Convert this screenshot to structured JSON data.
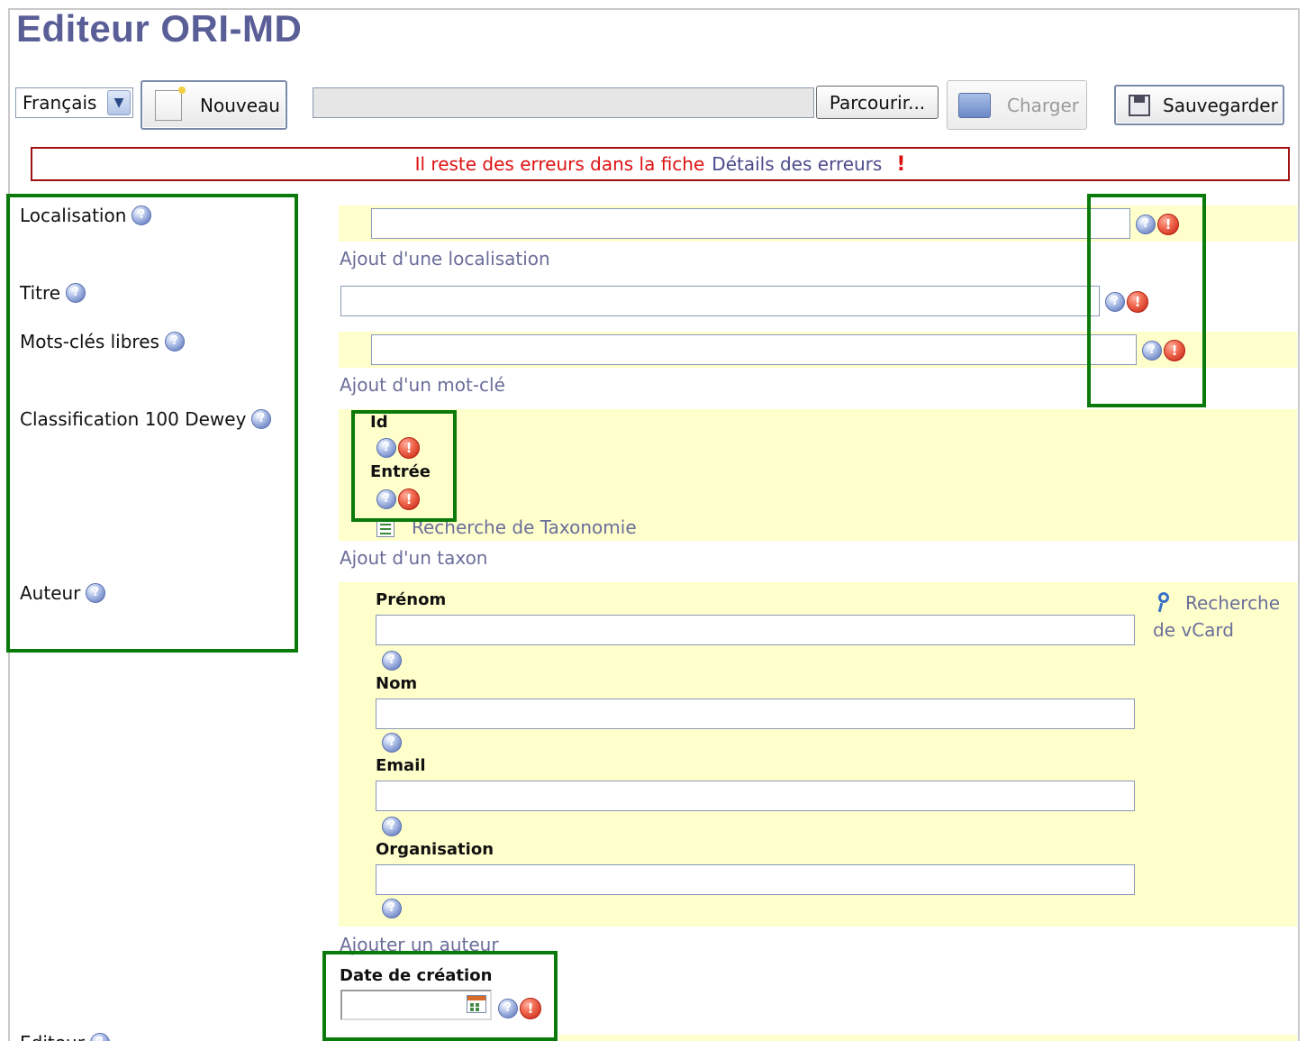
{
  "app": {
    "title": "Editeur ORI-MD"
  },
  "toolbar": {
    "language": "Français",
    "new_label": "Nouveau",
    "file_value": "",
    "browse_label": "Parcourir...",
    "load_label": "Charger",
    "save_label": "Sauvegarder"
  },
  "errors": {
    "message": "Il reste des erreurs dans la fiche",
    "details_link": "Détails des erreurs",
    "indicator": "!"
  },
  "fields": {
    "localisation": {
      "label": "Localisation",
      "value": "",
      "add_link": "Ajout d'une localisation"
    },
    "titre": {
      "label": "Titre",
      "value": ""
    },
    "mots_cles": {
      "label": "Mots-clés libres",
      "value": "",
      "add_link": "Ajout d'un mot-clé"
    },
    "classification": {
      "label": "Classification 100 Dewey",
      "id_label": "Id",
      "entree_label": "Entrée",
      "search_link": "Recherche de Taxonomie",
      "add_link": "Ajout d'un taxon"
    },
    "auteur": {
      "label": "Auteur",
      "prenom_label": "Prénom",
      "prenom_value": "",
      "nom_label": "Nom",
      "nom_value": "",
      "email_label": "Email",
      "email_value": "",
      "organisation_label": "Organisation",
      "organisation_value": "",
      "vcard_link_line1": "Recherche",
      "vcard_link_line2": "de vCard",
      "add_link": "Ajouter un auteur"
    },
    "date_creation": {
      "label": "Date de création",
      "value": ""
    },
    "editeur": {
      "label": "Editeur"
    }
  },
  "icons": {
    "help": "?",
    "error": "!"
  },
  "colors": {
    "title": "#5a5e96",
    "error_red": "#dd1111",
    "highlight_green": "#0a7a0a",
    "section_yellow": "#ffffcc",
    "link": "#6a6e9a"
  }
}
